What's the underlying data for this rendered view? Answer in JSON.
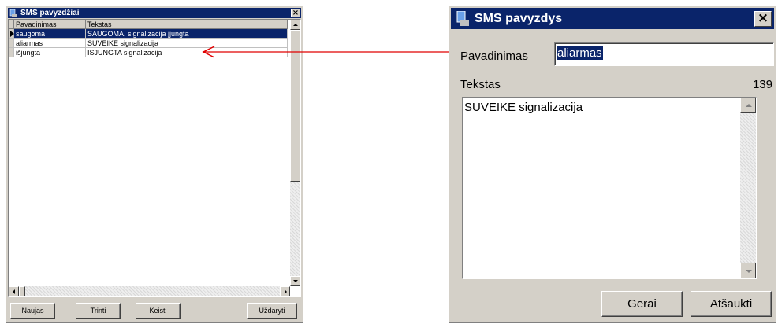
{
  "list_window": {
    "title": "SMS pavyzdžiai",
    "close_glyph": "×",
    "columns": [
      "Pavadinimas",
      "Tekstas"
    ],
    "rows": [
      {
        "name": "saugoma",
        "text": "SAUGOMA, signalizacija įjungta"
      },
      {
        "name": "aliarmas",
        "text": "SUVEIKE signalizacija"
      },
      {
        "name": "išjungta",
        "text": "ISJUNGTA signalizacija"
      }
    ],
    "selected_row": 0,
    "buttons": {
      "new": "Naujas",
      "delete": "Trinti",
      "edit": "Keisti",
      "close": "Uždaryti"
    }
  },
  "edit_dialog": {
    "title": "SMS pavyzdys",
    "close_glyph": "×",
    "name_label": "Pavadinimas",
    "name_value": "aliarmas",
    "text_label": "Tekstas",
    "char_count": "139",
    "text_value": "SUVEIKE signalizacija",
    "buttons": {
      "ok": "Gerai",
      "cancel": "Atšaukti"
    }
  },
  "colors": {
    "titlebar": "#0a246a",
    "arrow": "#e00000",
    "selection": "#0a246a"
  },
  "icons": {
    "window_icon": "app-window-icon",
    "annotation": "red-arrow"
  }
}
